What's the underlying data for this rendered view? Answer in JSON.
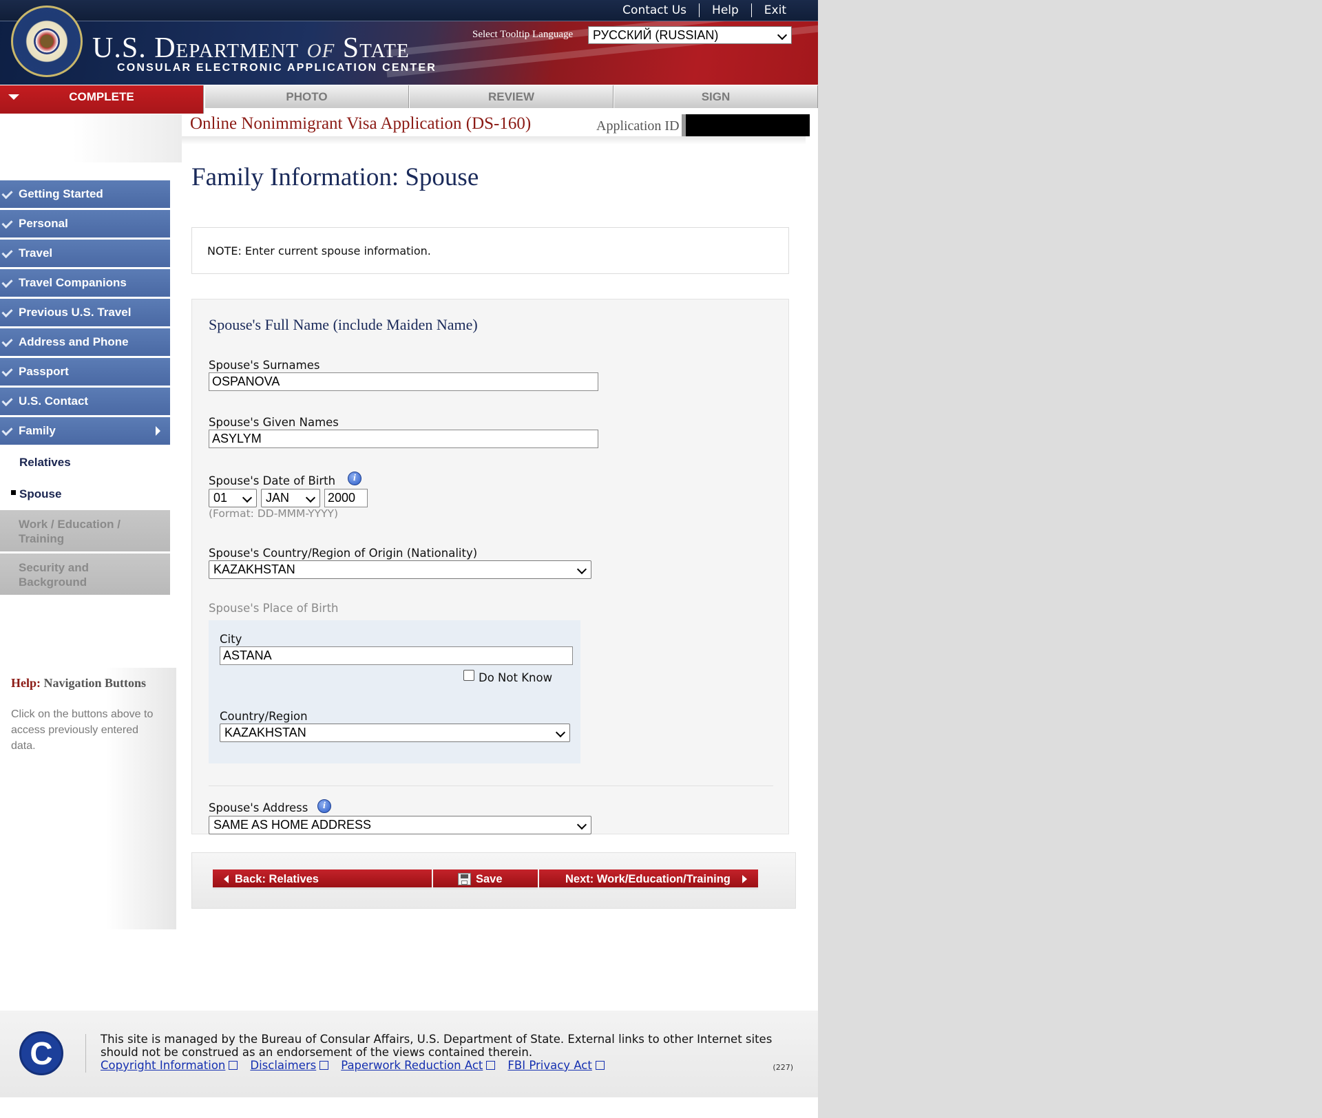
{
  "header": {
    "top_links": [
      "Contact Us",
      "Help",
      "Exit"
    ],
    "brand_title_prefix": "U.S. Department",
    "brand_title_of": "of",
    "brand_title_suffix": "State",
    "brand_subtitle": "CONSULAR ELECTRONIC APPLICATION CENTER",
    "tooltip_language_label": "Select Tooltip Language",
    "tooltip_language_value": "РУССКИЙ (RUSSIAN)"
  },
  "tabs": [
    {
      "label": "COMPLETE",
      "active": true
    },
    {
      "label": "PHOTO",
      "active": false
    },
    {
      "label": "REVIEW",
      "active": false
    },
    {
      "label": "SIGN",
      "active": false
    }
  ],
  "app": {
    "title": "Online Nonimmigrant Visa Application (DS-160)",
    "id_label": "Application ID"
  },
  "sidebar": {
    "items": [
      {
        "label": "Getting Started"
      },
      {
        "label": "Personal"
      },
      {
        "label": "Travel"
      },
      {
        "label": "Travel Companions"
      },
      {
        "label": "Previous U.S. Travel"
      },
      {
        "label": "Address and Phone"
      },
      {
        "label": "Passport"
      },
      {
        "label": "U.S. Contact"
      },
      {
        "label": "Family"
      }
    ],
    "sub_items": [
      {
        "label": "Relatives"
      },
      {
        "label": "Spouse"
      }
    ],
    "disabled_items": [
      {
        "label": "Work / Education / Training"
      },
      {
        "label": "Security and Background"
      }
    ]
  },
  "help": {
    "prefix": "Help:",
    "title": "Navigation Buttons",
    "text": "Click on the buttons above to access previously entered data."
  },
  "main": {
    "page_title": "Family Information: Spouse",
    "note": "NOTE: Enter current spouse information.",
    "section_title": "Spouse's Full Name (include Maiden Name)",
    "surnames_label": "Spouse's Surnames",
    "surnames_value": "OSPANOVA",
    "given_names_label": "Spouse's Given Names",
    "given_names_value": "ASYLYM",
    "dob_label": "Spouse's Date of Birth",
    "dob_day": "01",
    "dob_month": "JAN",
    "dob_year": "2000",
    "dob_format": "(Format: DD-MMM-YYYY)",
    "nationality_label": "Spouse's Country/Region of Origin (Nationality)",
    "nationality_value": "KAZAKHSTAN",
    "pob_label": "Spouse's Place of Birth",
    "city_label": "City",
    "city_value": "ASTANA",
    "do_not_know_label": "Do Not Know",
    "country_label": "Country/Region",
    "country_value": "KAZAKHSTAN",
    "address_label": "Spouse's Address",
    "address_value": "SAME AS HOME ADDRESS",
    "info_icon_glyph": "i"
  },
  "buttons": {
    "back": "Back: Relatives",
    "save": "Save",
    "next": "Next: Work/Education/Training"
  },
  "footer": {
    "logo_letter": "C",
    "text": "This site is managed by the Bureau of Consular Affairs, U.S. Department of State. External links to other Internet sites should not be construed as an endorsement of the views contained therein.",
    "links": [
      "Copyright Information",
      "Disclaimers",
      "Paperwork Reduction Act",
      "FBI Privacy Act"
    ],
    "version": "(227)"
  }
}
